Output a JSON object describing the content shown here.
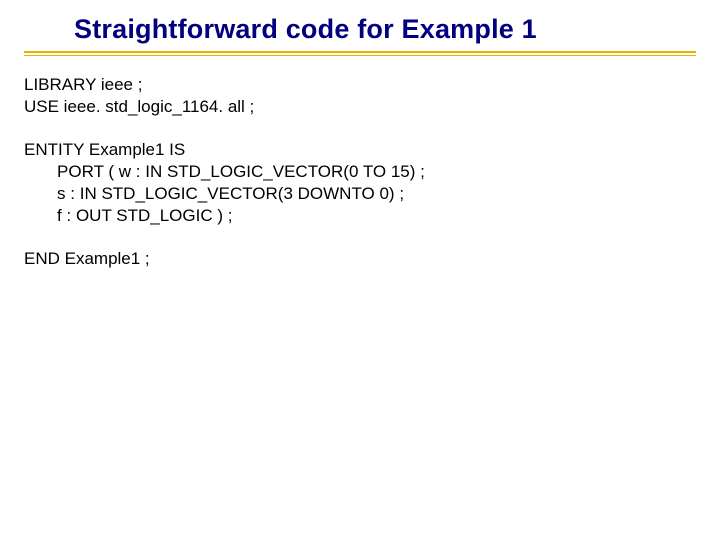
{
  "slide": {
    "title": "Straightforward code for Example 1",
    "code": "LIBRARY ieee ;\nUSE ieee. std_logic_1164. all ;\n\nENTITY Example1 IS\n       PORT ( w : IN STD_LOGIC_VECTOR(0 TO 15) ;\n       s : IN STD_LOGIC_VECTOR(3 DOWNTO 0) ;\n       f : OUT STD_LOGIC ) ;\n\nEND Example1 ;"
  }
}
